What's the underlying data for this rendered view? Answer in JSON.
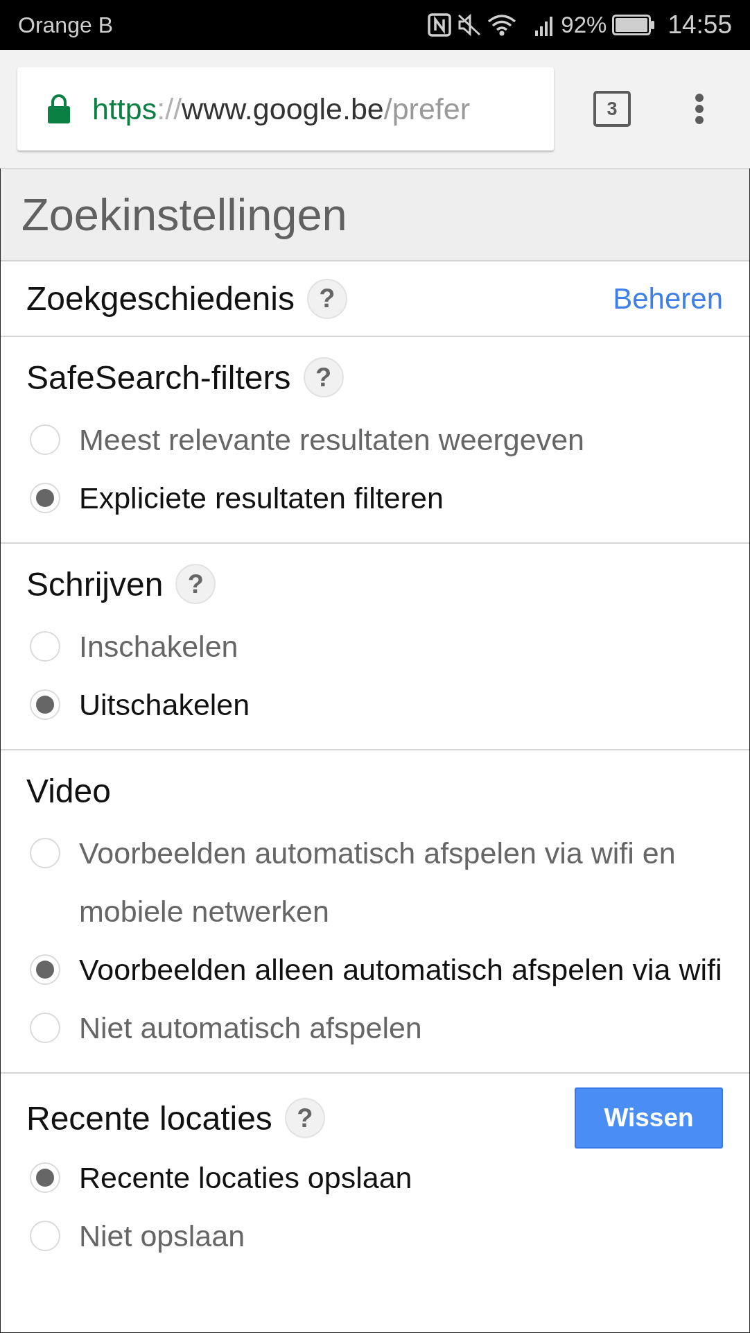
{
  "status_bar": {
    "carrier": "Orange B",
    "battery": "92%",
    "time": "14:55"
  },
  "browser_toolbar": {
    "url": {
      "scheme": "https",
      "separator": "://",
      "host": "www.google.be",
      "path": "/prefer"
    },
    "tab_count": "3"
  },
  "page": {
    "title": "Zoekinstellingen",
    "sections": [
      {
        "heading": "Zoekgeschiedenis",
        "help": "?",
        "link": "Beheren"
      },
      {
        "heading": "SafeSearch-filters",
        "help": "?",
        "options": [
          {
            "label": "Meest relevante resultaten weergeven",
            "selected": false
          },
          {
            "label": "Expliciete resultaten filteren",
            "selected": true
          }
        ]
      },
      {
        "heading": "Schrijven",
        "help": "?",
        "options": [
          {
            "label": "Inschakelen",
            "selected": false
          },
          {
            "label": "Uitschakelen",
            "selected": true
          }
        ]
      },
      {
        "heading": "Video",
        "options": [
          {
            "label": "Voorbeelden automatisch afspelen via wifi en mobiele netwerken",
            "selected": false
          },
          {
            "label": "Voorbeelden alleen automatisch afspelen via wifi",
            "selected": true
          },
          {
            "label": "Niet automatisch afspelen",
            "selected": false
          }
        ]
      },
      {
        "heading": "Recente locaties",
        "help": "?",
        "button": "Wissen",
        "options": [
          {
            "label": "Recente locaties opslaan",
            "selected": true
          },
          {
            "label": "Niet opslaan",
            "selected": false
          }
        ]
      }
    ]
  }
}
